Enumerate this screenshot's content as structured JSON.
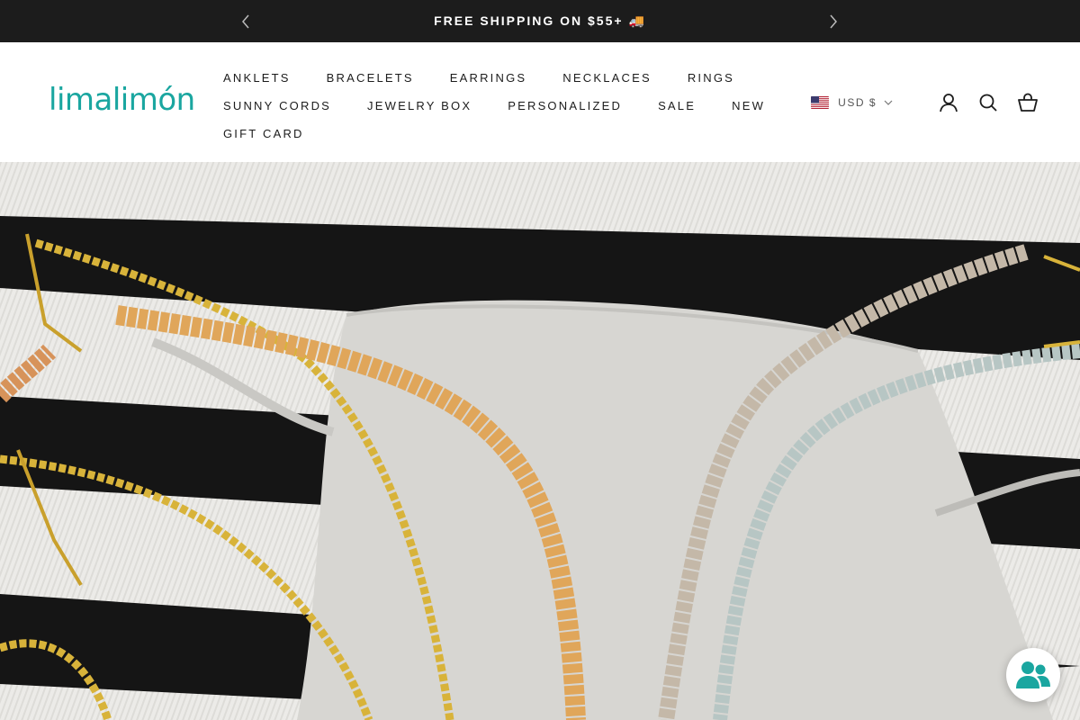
{
  "announcement": {
    "text": "FREE SHIPPING ON $55+ 🚚"
  },
  "header": {
    "logo_text": "limalimón",
    "nav": {
      "row1": [
        "ANKLETS",
        "BRACELETS",
        "EARRINGS",
        "NECKLACES",
        "RINGS"
      ],
      "row2": [
        "SUNNY CORDS",
        "JEWELRY BOX",
        "PERSONALIZED",
        "SALE",
        "NEW"
      ],
      "row3": [
        "GIFT CARD"
      ]
    },
    "currency": {
      "label": "USD $",
      "flag": "us-flag-icon"
    },
    "icons": [
      "account-icon",
      "search-icon",
      "cart-icon"
    ]
  },
  "hero": {
    "description_icon": "hero-image"
  },
  "colors": {
    "announcement_bg": "#1c1c1c",
    "brand_teal": "#1aa6a0",
    "text_dark": "#1c1c1c"
  }
}
